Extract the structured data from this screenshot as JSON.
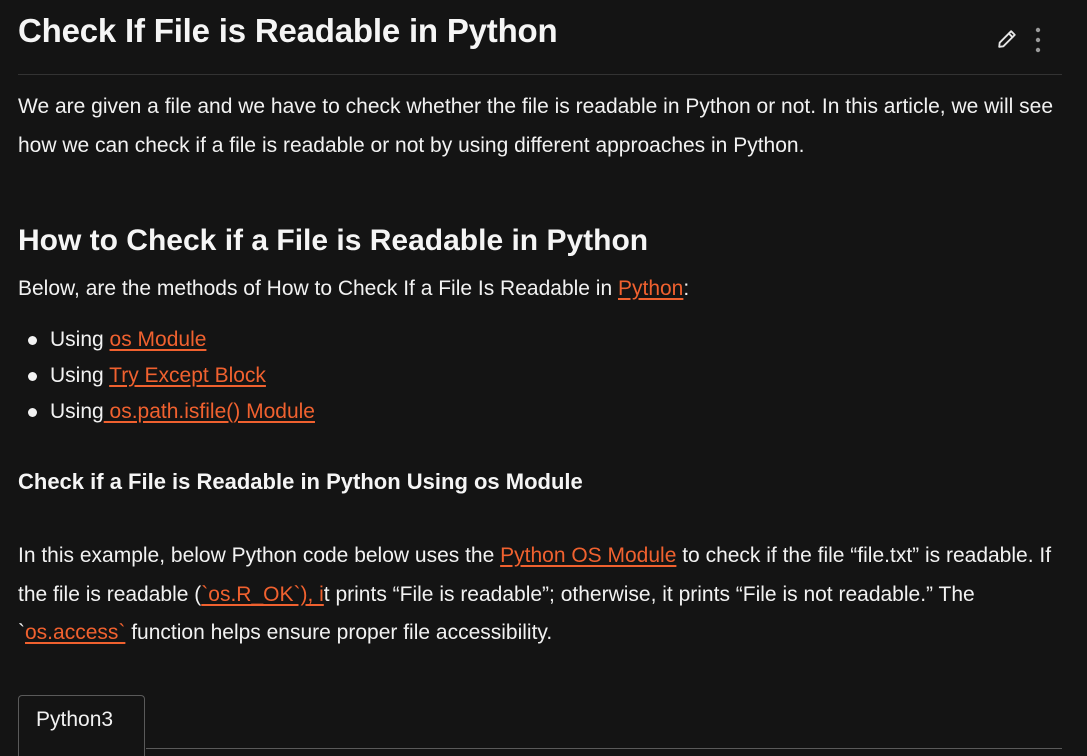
{
  "article": {
    "title": "Check If File is Readable in Python",
    "toolbar": {
      "edit_icon": "pencil-icon",
      "more_icon": "vertical-dots-icon"
    },
    "intro": "We are given a file and we have to check whether the file is readable in Python or not. In this article, we will see how we can check if a file is readable or not by using different approaches in Python.",
    "section_heading": "How to Check if a File is Readable in Python",
    "methods_intro": {
      "before": "Below, are the methods of How to Check If a File Is Readable in ",
      "link": "Python",
      "after": ":"
    },
    "methods": [
      {
        "prefix": "Using ",
        "link": "os Module"
      },
      {
        "prefix": "Using ",
        "link": "Try Except Block"
      },
      {
        "prefix": "Using",
        "link": " os.path.isfile() Module"
      }
    ],
    "subheading": "Check if a File is Readable in Python Using os Module",
    "example": {
      "p1": "In this example, below Python code below uses the ",
      "link1": "Python OS Module",
      "p2": " to check if the file “file.txt” is readable. If the file is readable (",
      "link2": "`os.R_OK`), i",
      "p3": "t prints “File is readable”; otherwise, it prints “File is not readable.” The `",
      "link3": "os.access`",
      "p4": " function helps ensure proper file accessibility."
    },
    "code_tab": "Python3"
  },
  "colors": {
    "background": "#141414",
    "text": "#f2f2f2",
    "link": "#f0612f",
    "divider": "#333333"
  }
}
